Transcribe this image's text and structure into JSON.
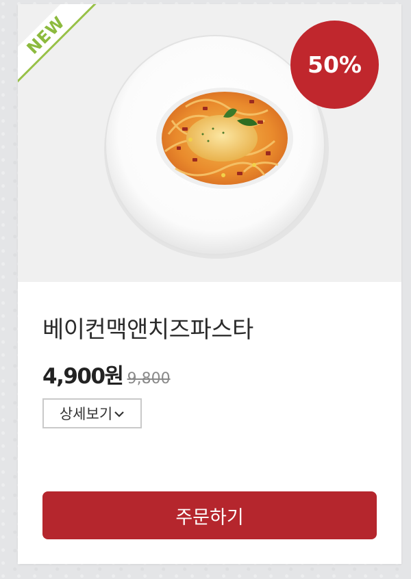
{
  "product": {
    "badge_new": "NEW",
    "discount": "50%",
    "name": "베이컨맥앤치즈파스타",
    "price": "4,900원",
    "original_price": "9,800",
    "image_icon": "pasta-plate-icon"
  },
  "actions": {
    "detail_label": "상세보기",
    "detail_icon": "chevron-down-icon",
    "order_label": "주문하기"
  },
  "colors": {
    "accent_red": "#c0272d",
    "button_red": "#b5262d",
    "new_green": "#8cba3e"
  }
}
